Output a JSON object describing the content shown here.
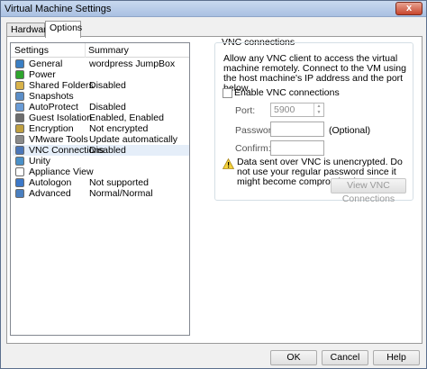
{
  "window": {
    "title": "Virtual Machine Settings",
    "close_label": "x"
  },
  "tabs": [
    {
      "label": "Hardware"
    },
    {
      "label": "Options"
    }
  ],
  "settings_list": {
    "headers": {
      "settings": "Settings",
      "summary": "Summary"
    },
    "items": [
      {
        "name": "General",
        "summary": "wordpress JumpBox",
        "icon": "general-icon",
        "color": "#3a7fc4"
      },
      {
        "name": "Power",
        "summary": "",
        "icon": "power-icon",
        "color": "#2ea52e"
      },
      {
        "name": "Shared Folders",
        "summary": "Disabled",
        "icon": "shared-folders-icon",
        "color": "#d8b24a"
      },
      {
        "name": "Snapshots",
        "summary": "",
        "icon": "snapshots-icon",
        "color": "#5b8ec8"
      },
      {
        "name": "AutoProtect",
        "summary": "Disabled",
        "icon": "autoprotect-icon",
        "color": "#6a9cd6"
      },
      {
        "name": "Guest Isolation",
        "summary": "Enabled, Enabled",
        "icon": "guest-isolation-icon",
        "color": "#6d6d6d"
      },
      {
        "name": "Encryption",
        "summary": "Not encrypted",
        "icon": "encryption-icon",
        "color": "#c0a040"
      },
      {
        "name": "VMware Tools",
        "summary": "Update automatically",
        "icon": "vmware-tools-icon",
        "color": "#8a8a8a"
      },
      {
        "name": "VNC Connections",
        "summary": "Disabled",
        "icon": "vnc-connections-icon",
        "color": "#4a76b8"
      },
      {
        "name": "Unity",
        "summary": "",
        "icon": "unity-icon",
        "color": "#4a90c8"
      },
      {
        "name": "Appliance View",
        "summary": "",
        "icon": "appliance-view-icon",
        "color": "#ffffff"
      },
      {
        "name": "Autologon",
        "summary": "Not supported",
        "icon": "autologon-icon",
        "color": "#3c78c8"
      },
      {
        "name": "Advanced",
        "summary": "Normal/Normal",
        "icon": "advanced-icon",
        "color": "#4a7fbf"
      }
    ],
    "selected_index": 8
  },
  "vnc": {
    "group_title": "VNC connections",
    "description": "Allow any VNC client to access the virtual machine remotely. Connect to the VM using the host machine's IP address and the port below.",
    "enable_label": "Enable VNC connections",
    "enabled": false,
    "port_label": "Port:",
    "port_value": "5900",
    "password_label": "Password:",
    "optional_label": "(Optional)",
    "confirm_label": "Confirm:",
    "warning": "Data sent over VNC is unencrypted. Do not use your regular password since it might become compromised.",
    "view_button": "View VNC Connections"
  },
  "footer": {
    "ok": "OK",
    "cancel": "Cancel",
    "help": "Help"
  }
}
